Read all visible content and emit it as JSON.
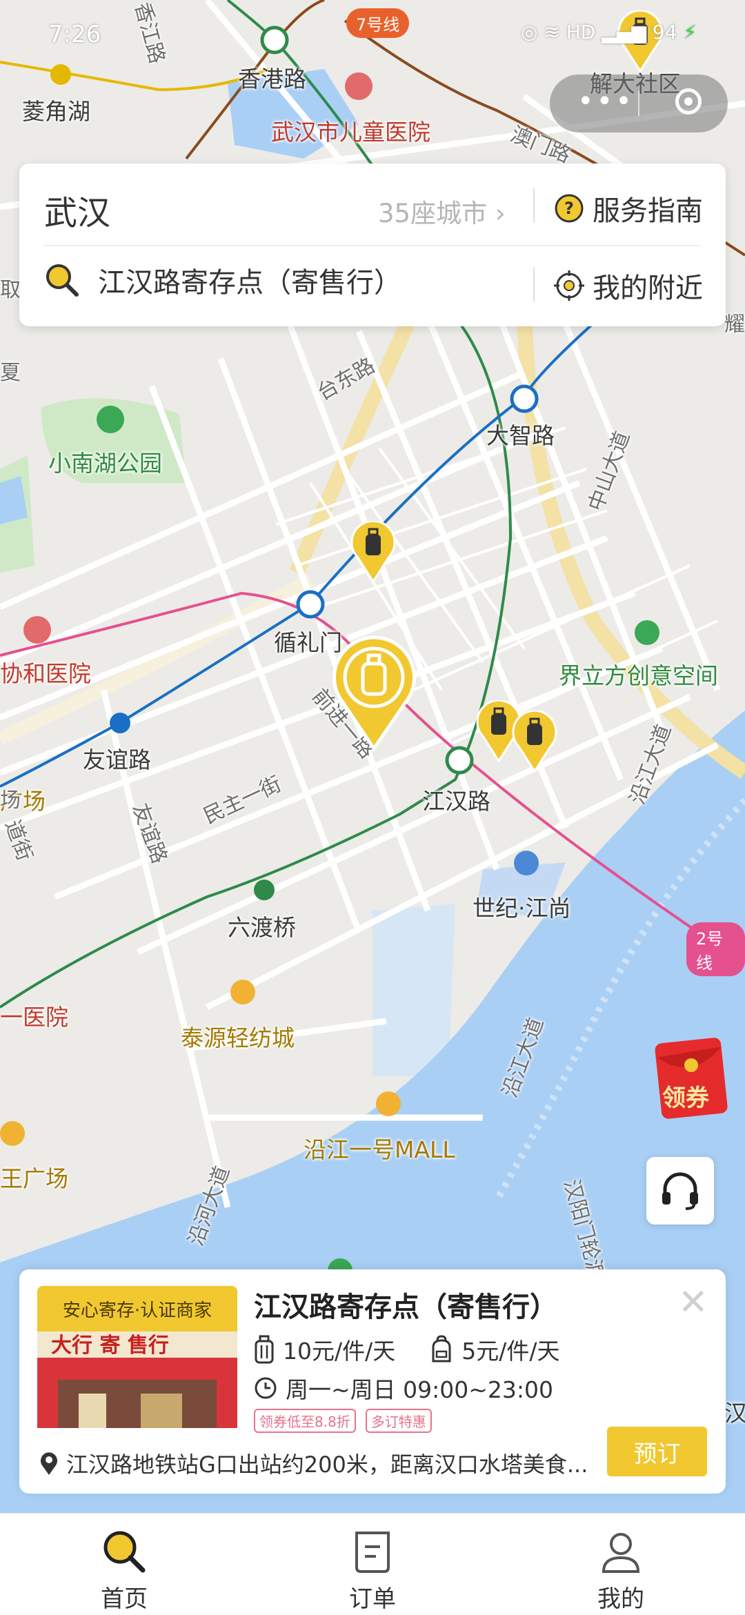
{
  "status_bar": {
    "time": "7:26",
    "network": "HD",
    "battery": "94"
  },
  "mini_program_capsule": {
    "more_icon": "more-dots-icon",
    "close_icon": "target-circle-icon"
  },
  "header": {
    "city": "武汉",
    "city_count": "35座城市",
    "guide_label": "服务指南",
    "search_value": "江汉路寄存点（寄售行）",
    "nearby_label": "我的附近"
  },
  "map": {
    "metro_line_labels": [
      "7号线",
      "2号线"
    ],
    "stations": [
      "香港路",
      "菱角湖",
      "大智路",
      "循礼门",
      "友谊路",
      "江汉路",
      "六渡桥"
    ],
    "places": [
      "武汉市儿童医院",
      "解大社区",
      "小南湖公园",
      "协和医院",
      "界立方创意空间",
      "世纪·江尚",
      "泰源轻纺城",
      "沿江一号MALL",
      "一医院",
      "广场",
      "王广场",
      "汉"
    ],
    "roads": [
      "澳门路",
      "台东路",
      "中山大道",
      "前进一路",
      "民主一街",
      "友谊路",
      "沿江大道",
      "沿江大道",
      "沿河大道",
      "汉阳门轮渡",
      "香江路",
      "耀",
      "取",
      "夏",
      "场",
      "道街"
    ]
  },
  "side_buttons": {
    "coupon_label": "领券",
    "service_icon": "headset-icon"
  },
  "store_card": {
    "badge": "安心寄存·认证商家",
    "name": "江汉路寄存点（寄售行）",
    "price_luggage": "10元/件/天",
    "price_bag": "5元/件/天",
    "hours": "周一~周日 09:00~23:00",
    "tags": [
      "领券低至8.8折",
      "多订特惠"
    ],
    "address": "江汉路地铁站G口出站约200米，距离汉口水塔美食...",
    "book_label": "预订"
  },
  "tabs": [
    {
      "label": "首页",
      "icon": "search-icon",
      "active": true
    },
    {
      "label": "订单",
      "icon": "order-icon",
      "active": false
    },
    {
      "label": "我的",
      "icon": "person-icon",
      "active": false
    }
  ],
  "colors": {
    "accent": "#f1c830",
    "line_green": "#2f8a4a",
    "line_blue": "#1a6fc4",
    "line_pink": "#e5508f",
    "line_brown": "#8b4a1e",
    "water": "#a9cff5"
  }
}
